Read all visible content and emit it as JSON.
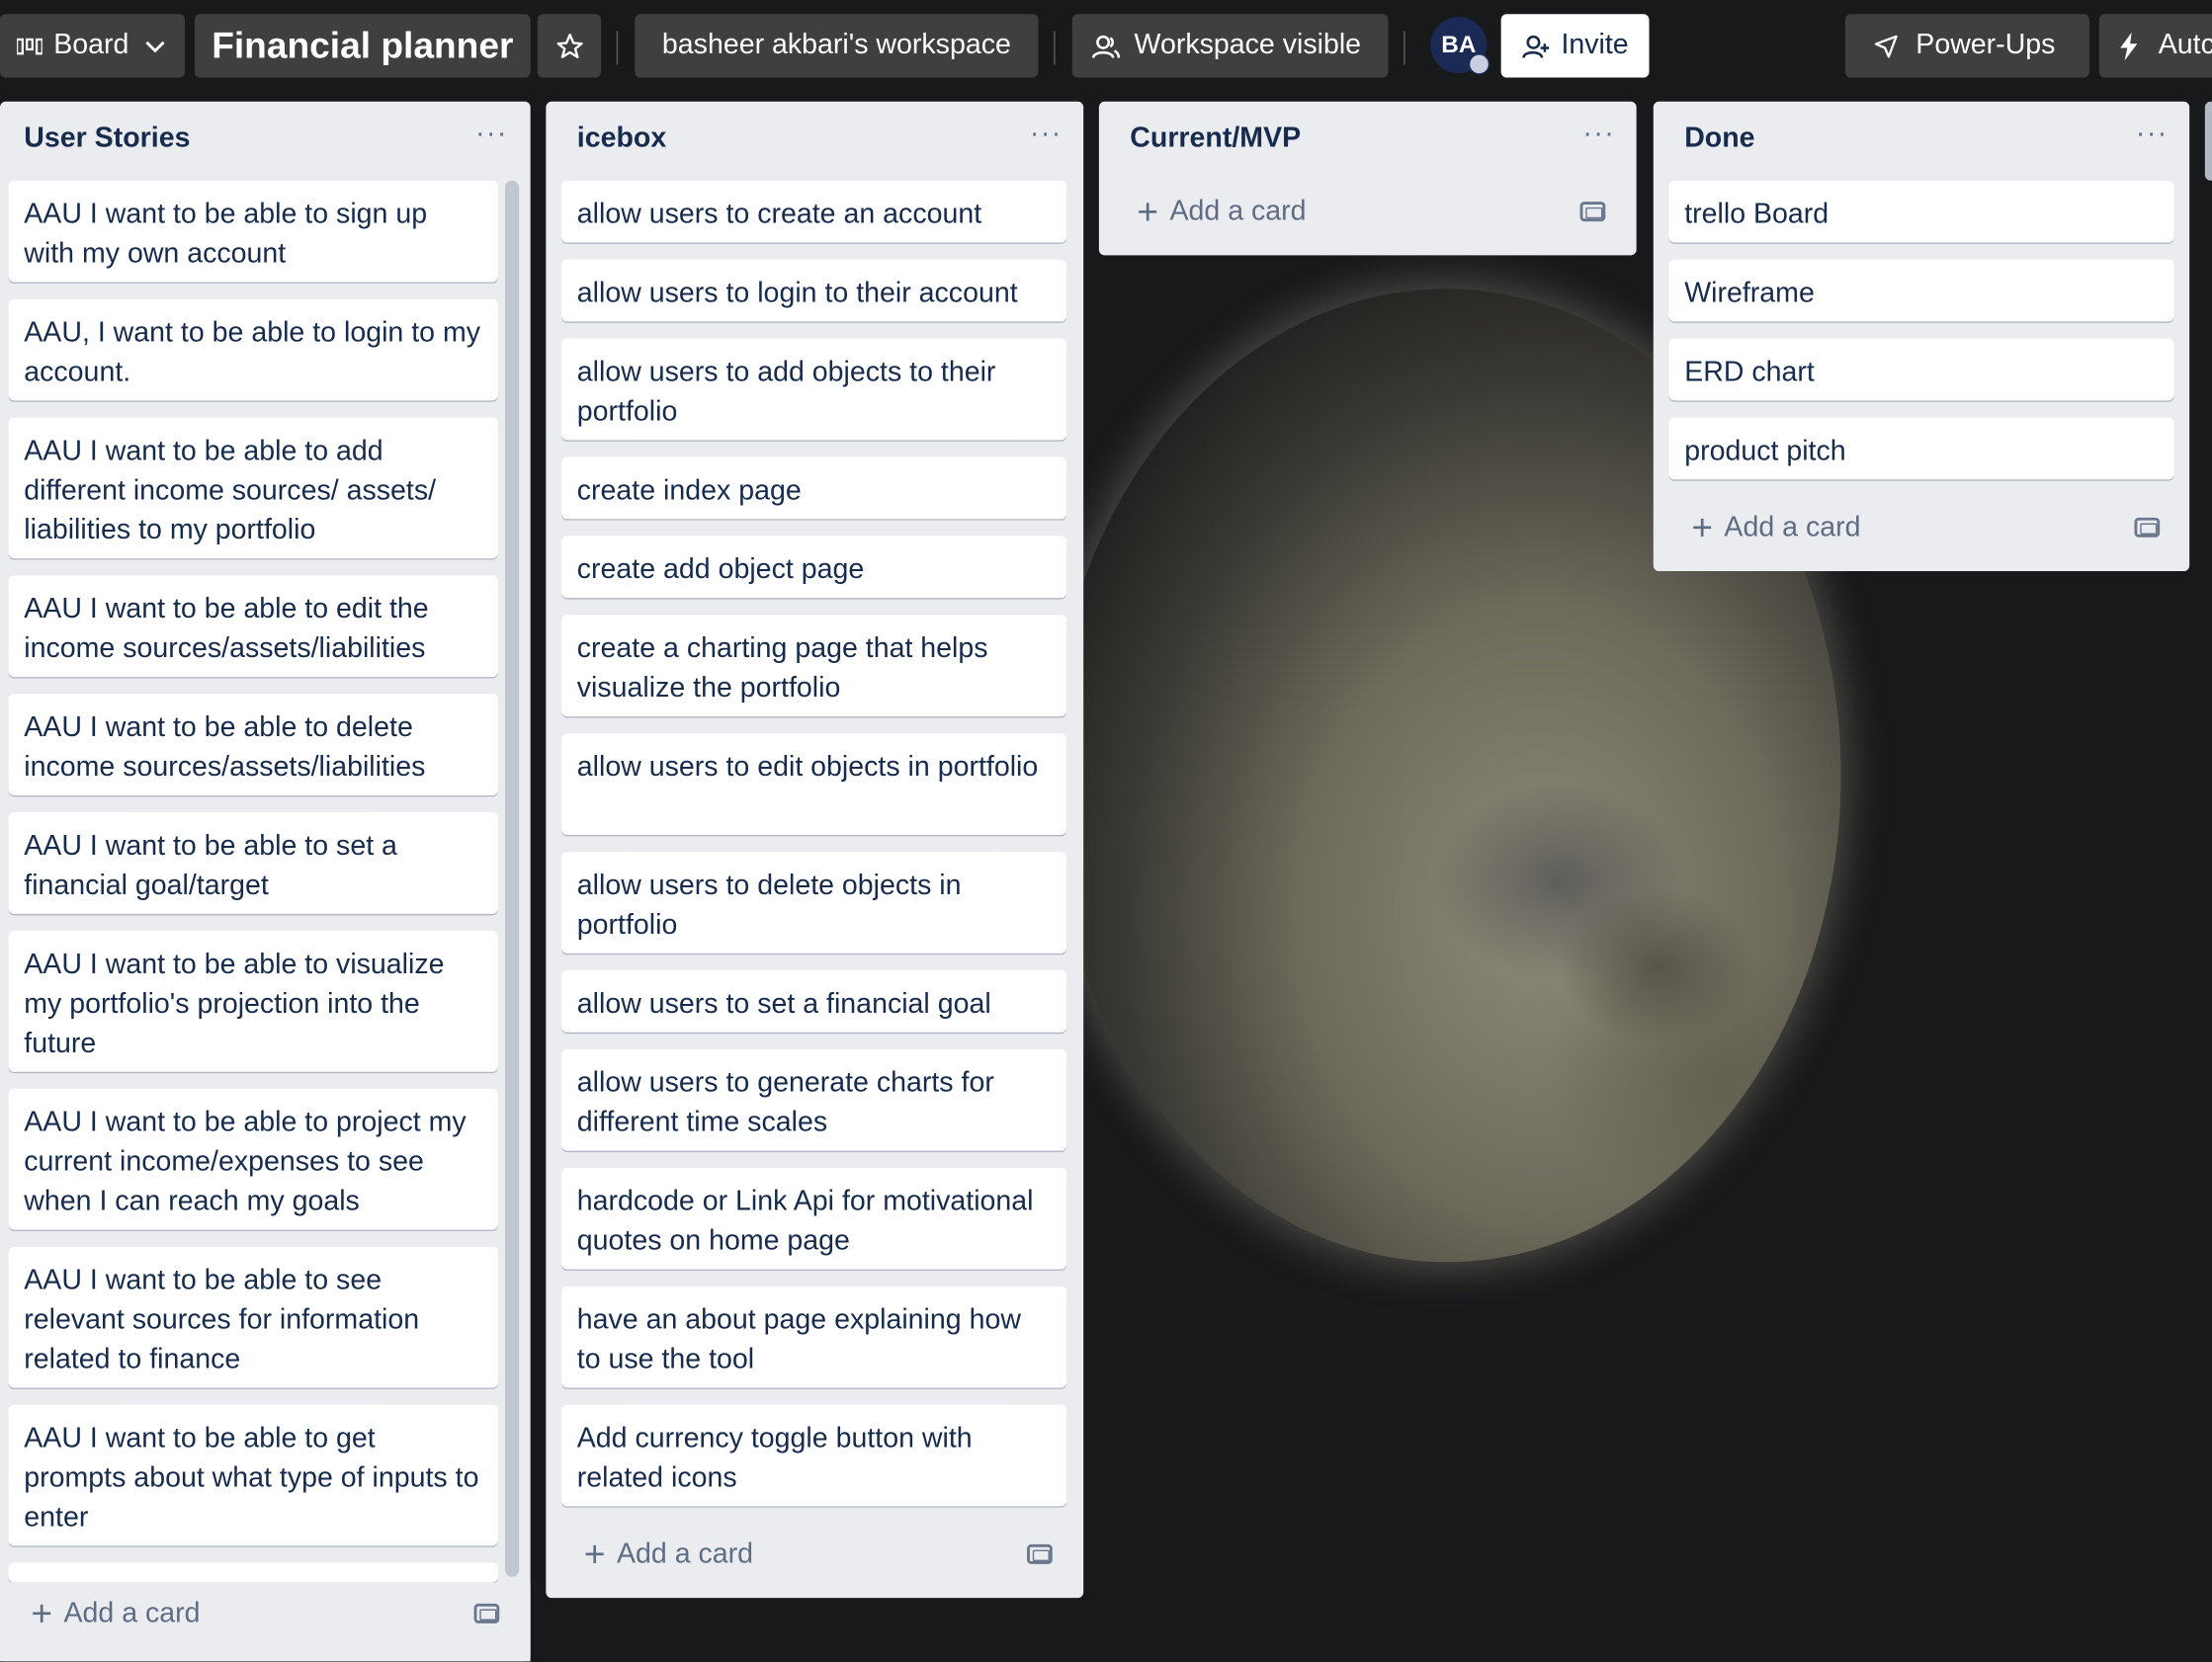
{
  "header": {
    "view_label": "Board",
    "board_title": "Financial planner",
    "workspace": "basheer akbari's workspace",
    "visibility": "Workspace visible",
    "avatar_initials": "BA",
    "invite_label": "Invite",
    "powerups_label": "Power-Ups",
    "automation_label": "Autc"
  },
  "lists": {
    "user_stories": {
      "title": "User Stories",
      "cards": [
        "AAU I want to be able to sign up with my own account",
        "AAU, I want to be able to login to my account.",
        "AAU I want to be able to add different income sources/ assets/ liabilities to my portfolio",
        "AAU I want to be able to edit the income sources/assets/liabilities",
        "AAU I want to be able to delete income sources/assets/liabilities",
        "AAU I want to be able to set a financial goal/target",
        "AAU I want to be able to visualize my portfolio's projection into the future",
        "AAU I want to be able to project my current income/expenses to see when I can reach my goals",
        "AAU I want to be able to see relevant sources for information related to finance",
        "AAU I want to be able to get prompts about what type of inputs to enter"
      ],
      "add_label": "Add a card"
    },
    "icebox": {
      "title": "icebox",
      "cards": [
        "allow users to create an account",
        "allow users to login to their account",
        "allow users to add objects to their portfolio",
        "create index page",
        "create add object page",
        "create a charting page that helps visualize the portfolio",
        "allow users to edit objects in portfolio",
        "allow users to delete objects in portfolio",
        "allow users to set a financial goal",
        "allow users to generate charts for different time scales",
        "hardcode or Link Api for motivational quotes on home page",
        "have an about page explaining how to use the tool",
        "Add currency toggle button with related icons"
      ],
      "add_label": "Add a card"
    },
    "current": {
      "title": "Current/MVP",
      "add_label": "Add a card"
    },
    "done": {
      "title": "Done",
      "cards": [
        "trello Board",
        "Wireframe",
        "ERD chart",
        "product pitch"
      ],
      "add_label": "Add a card"
    }
  },
  "icons": {
    "board_view": "board-view-icon",
    "chevron": "chevron-down-icon",
    "star": "star-icon",
    "visibility": "people-icon",
    "invite": "add-person-icon",
    "powerups": "rocket-icon",
    "automation": "lightning-icon",
    "more": "more-icon",
    "plus": "plus-icon",
    "template": "card-template-icon"
  },
  "colors": {
    "list_bg": "#ebecf0",
    "card_bg": "#ffffff",
    "text": "#172b4d",
    "board_bg": "#18191b"
  }
}
